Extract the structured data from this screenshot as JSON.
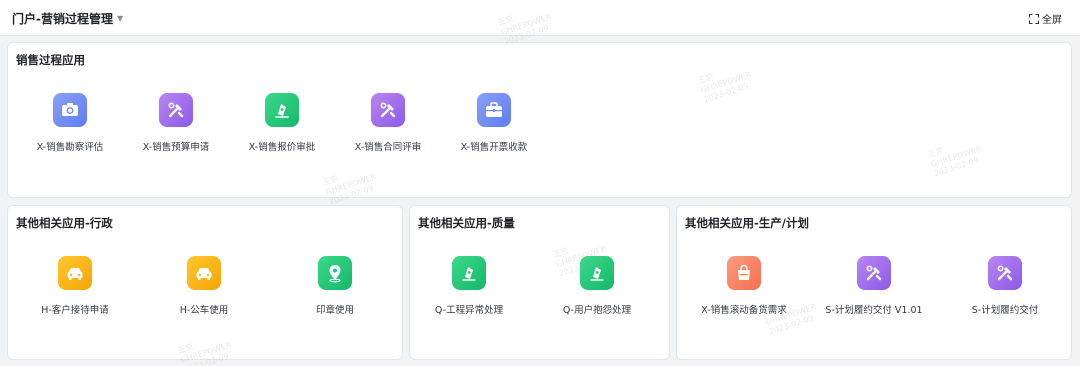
{
  "header": {
    "portal_title": "门户-营销过程管理",
    "fullscreen_label": "全屏"
  },
  "cards": [
    {
      "title": "销售过程应用",
      "apps": [
        {
          "label": "X-销售勘察评估",
          "icon": "camera-icon",
          "color": "#6f8cf3"
        },
        {
          "label": "X-销售预算申请",
          "icon": "tools-icon",
          "color": "#a06df0"
        },
        {
          "label": "X-销售报价审批",
          "icon": "pen-icon",
          "color": "#1ec978"
        },
        {
          "label": "X-销售合同评审",
          "icon": "tools-icon",
          "color": "#a06df0"
        },
        {
          "label": "X-销售开票收款",
          "icon": "briefcase-icon",
          "color": "#6f8cf3"
        }
      ]
    },
    {
      "title": "其他相关应用-行政",
      "apps": [
        {
          "label": "H-客户接待申请",
          "icon": "car-icon",
          "color": "#f9b617"
        },
        {
          "label": "H-公车使用",
          "icon": "car-icon",
          "color": "#f9b617"
        },
        {
          "label": "印章使用",
          "icon": "location-icon",
          "color": "#1ec978"
        }
      ]
    },
    {
      "title": "其他相关应用-质量",
      "apps": [
        {
          "label": "Q-工程异常处理",
          "icon": "pen-icon",
          "color": "#1ec978"
        },
        {
          "label": "Q-用户抱怨处理",
          "icon": "pen-icon",
          "color": "#1ec978"
        }
      ]
    },
    {
      "title": "其他相关应用-生产/计划",
      "apps": [
        {
          "label": "X-销售滚动备货需求",
          "icon": "bag-icon",
          "color": "#f7835f"
        },
        {
          "label": "S-计划履约交付 V1.01",
          "icon": "tools-icon",
          "color": "#a06df0"
        },
        {
          "label": "S-计划履约交付",
          "icon": "tools-icon",
          "color": "#a06df0"
        }
      ]
    }
  ],
  "watermark": {
    "lines": [
      "王京",
      "GHREPOWER",
      "2023-02-09"
    ]
  }
}
